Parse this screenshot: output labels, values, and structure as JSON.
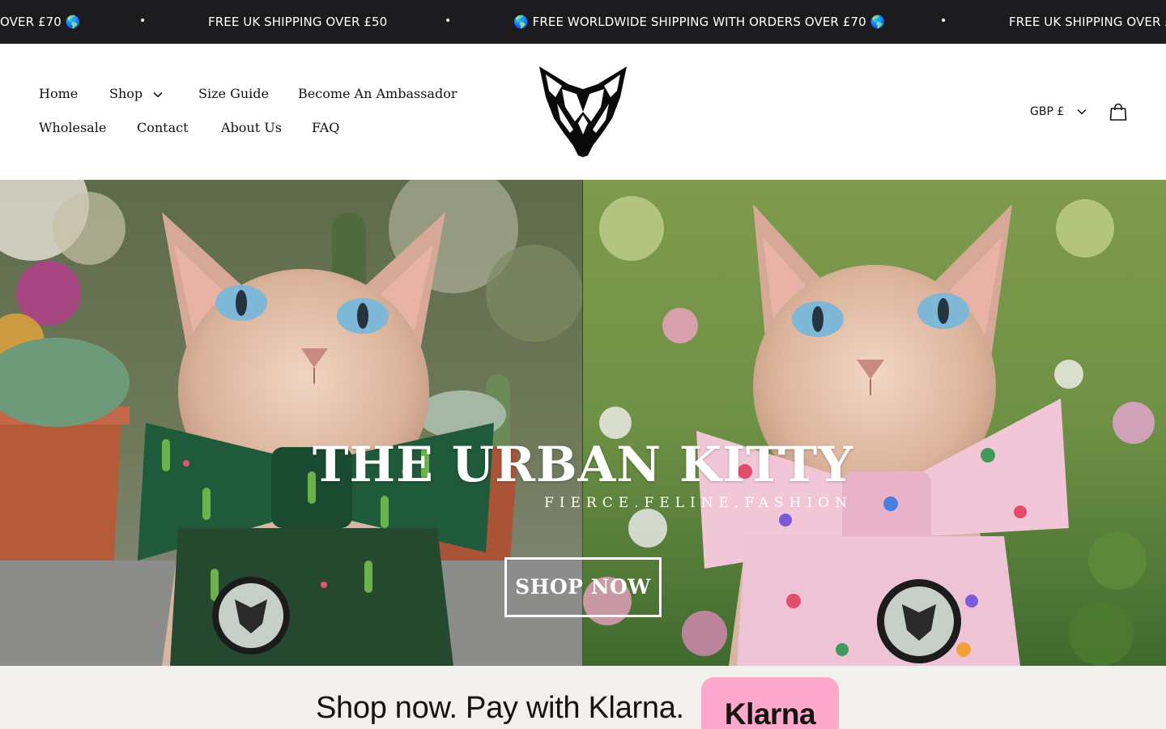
{
  "announcement": {
    "messages": [
      "OVER £70 🌎",
      "FREE UK SHIPPING OVER £50",
      "🌎 FREE WORLDWIDE SHIPPING WITH ORDERS OVER £70 🌎",
      "FREE UK SHIPPING OVER £50"
    ],
    "separator": "•",
    "background": "#1c1c1e"
  },
  "nav": {
    "home": "Home",
    "shop": "Shop",
    "size_guide": "Size Guide",
    "ambassador": "Become An Ambassador",
    "wholesale": "Wholesale",
    "contact": "Contact",
    "about": "About Us",
    "faq": "FAQ"
  },
  "header": {
    "logo_icon": "cat-head-logo-icon",
    "currency": "GBP £",
    "cart_icon": "shopping-bag-icon"
  },
  "hero": {
    "title": "THE URBAN KITTY",
    "tagline": "FIERCE.FELINE.FASHION",
    "cta": "SHOP NOW",
    "left_image": "sphynx cat wearing green cactus-print bow tie and harness",
    "right_image": "sphynx cat wearing pink floral-print bow tie and harness"
  },
  "klarna": {
    "text": "Shop now. Pay with Klarna.",
    "badge": "Klarna",
    "badge_color": "#ffa8cd"
  }
}
